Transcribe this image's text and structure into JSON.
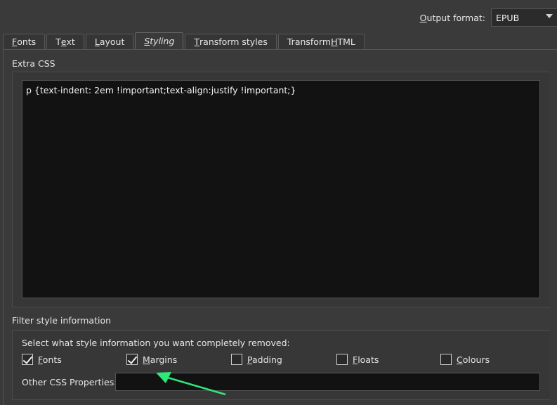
{
  "output_format": {
    "label_prefix": "O",
    "label_rest": "utput format:",
    "value": "EPUB"
  },
  "tabs": [
    {
      "u": "F",
      "rest": "onts"
    },
    {
      "pre": "T",
      "u": "e",
      "rest": "xt"
    },
    {
      "u": "L",
      "rest": "ayout"
    },
    {
      "u": "S",
      "rest": "tyling"
    },
    {
      "u": "T",
      "rest": "ransform styles"
    },
    {
      "pre": "Transform ",
      "u": "H",
      "rest": "TML"
    }
  ],
  "extra_css": {
    "title": "Extra CSS",
    "content": "p {text-indent: 2em !important;text-align:justify !important;}"
  },
  "filter": {
    "title": "Filter style information",
    "hint": "Select what style information you want completely removed:",
    "options": [
      {
        "label": "Fonts",
        "checked": true
      },
      {
        "label": "Margins",
        "checked": true
      },
      {
        "label": "Padding",
        "checked": false
      },
      {
        "label": "Floats",
        "checked": false
      },
      {
        "label": "Colours",
        "checked": false
      }
    ],
    "other_label": "Other CSS Properties:",
    "other_value": ""
  },
  "colors": {
    "arrow": "#2ee87a"
  }
}
